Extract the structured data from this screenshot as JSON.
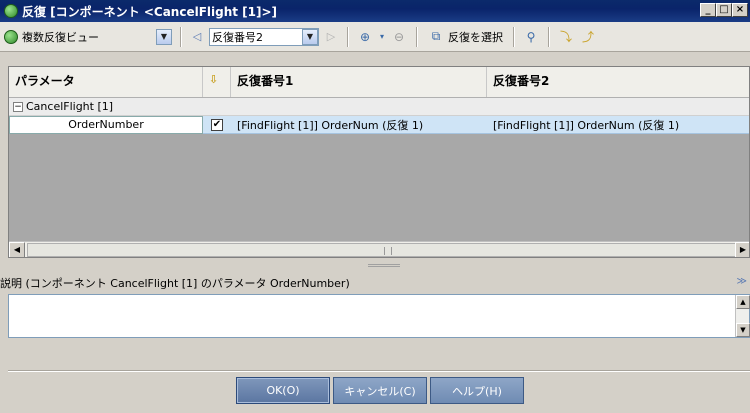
{
  "window": {
    "title": "反復 [コンポーネント <CancelFlight [1]>]",
    "controls": [
      "minimize-icon",
      "maximize-icon",
      "close-icon"
    ]
  },
  "toolbar": {
    "view_label": "複数反復ビュー",
    "iteration_selected": "反復番号2",
    "select_iterations_label": "反復を選択"
  },
  "grid": {
    "columns": [
      "パラメータ",
      "",
      "反復番号1",
      "反復番号2"
    ],
    "group": {
      "expander": "−",
      "label": "CancelFlight [1]"
    },
    "rows": [
      {
        "param": "OrderNumber",
        "checked": "✔",
        "iter1": "[FindFlight [1]] OrderNum (反復 1)",
        "iter2": "[FindFlight [1]] OrderNum (反復 1)"
      }
    ]
  },
  "description": {
    "label": "説明 (コンポーネント CancelFlight [1] のパラメータ OrderNumber)",
    "text": ""
  },
  "buttons": {
    "ok": "OK(O)",
    "cancel": "キャンセル(C)",
    "help": "ヘルプ(H)"
  }
}
